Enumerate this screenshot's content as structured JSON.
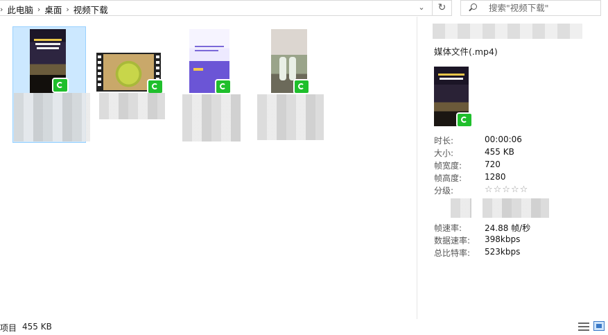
{
  "address": {
    "breadcrumbs": [
      "此电脑",
      "桌面",
      "视频下载"
    ],
    "separator": "›"
  },
  "search": {
    "placeholder": "搜索\"视频下载\""
  },
  "files": [
    {
      "label_visible": "",
      "selected": true
    },
    {
      "label_visible": "",
      "selected": false
    },
    {
      "label_visible": "",
      "selected": false
    },
    {
      "label_visible": "",
      "selected": false
    }
  ],
  "details": {
    "type": "媒体文件(.mp4)",
    "props": [
      {
        "key": "时长:",
        "value": "00:00:06"
      },
      {
        "key": "大小:",
        "value": "455 KB"
      },
      {
        "key": "帧宽度:",
        "value": "720"
      },
      {
        "key": "帧高度:",
        "value": "1280"
      },
      {
        "key": "分级:",
        "value": "☆☆☆☆☆"
      },
      {
        "key": "帧速率:",
        "value": "24.88 帧/秒"
      },
      {
        "key": "数据速率:",
        "value": "398kbps"
      },
      {
        "key": "总比特率:",
        "value": "523kbps"
      }
    ],
    "rating_stars": 0
  },
  "status": {
    "items_label": "项目",
    "size": "455 KB"
  },
  "colors": {
    "selection": "#cce8ff",
    "badge": "#1fbf2c",
    "accent": "#3a79c7"
  },
  "icons": [
    "chevron-down-icon",
    "refresh-icon",
    "search-icon",
    "details-view-icon",
    "large-icons-view-icon"
  ]
}
